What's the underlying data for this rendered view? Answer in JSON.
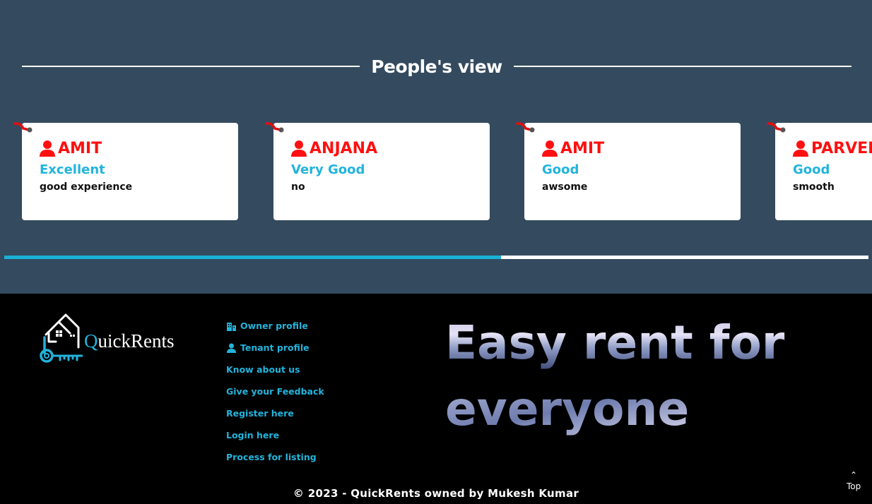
{
  "reviews": {
    "title": "People's view",
    "progress": 0.575,
    "items": [
      {
        "name": "AMIT",
        "rating": "Excellent",
        "comment": "good experience"
      },
      {
        "name": "ANJANA",
        "rating": "Very Good",
        "comment": "no"
      },
      {
        "name": "AMIT",
        "rating": "Good",
        "comment": "awsome"
      },
      {
        "name": "PARVEEN",
        "rating": "Good",
        "comment": "smooth"
      }
    ]
  },
  "footer": {
    "logo": {
      "first": "Q",
      "rest": "uickRents"
    },
    "links": [
      {
        "label": "Owner profile",
        "icon": "building-icon"
      },
      {
        "label": "Tenant profile",
        "icon": "user-icon"
      },
      {
        "label": "Know about us"
      },
      {
        "label": "Give your Feedback"
      },
      {
        "label": "Register here"
      },
      {
        "label": "Login here"
      },
      {
        "label": "Process for listing"
      }
    ],
    "hero": {
      "line1": "Easy rent for",
      "line2": "everyone"
    },
    "copyright": "© 2023 - QuickRents owned by Mukesh Kumar",
    "top_label": "Top"
  },
  "colors": {
    "section_bg": "#344a5e",
    "name": "#ff1010",
    "accent": "#22b4dc",
    "progress_fill": "#1ab1d6"
  }
}
